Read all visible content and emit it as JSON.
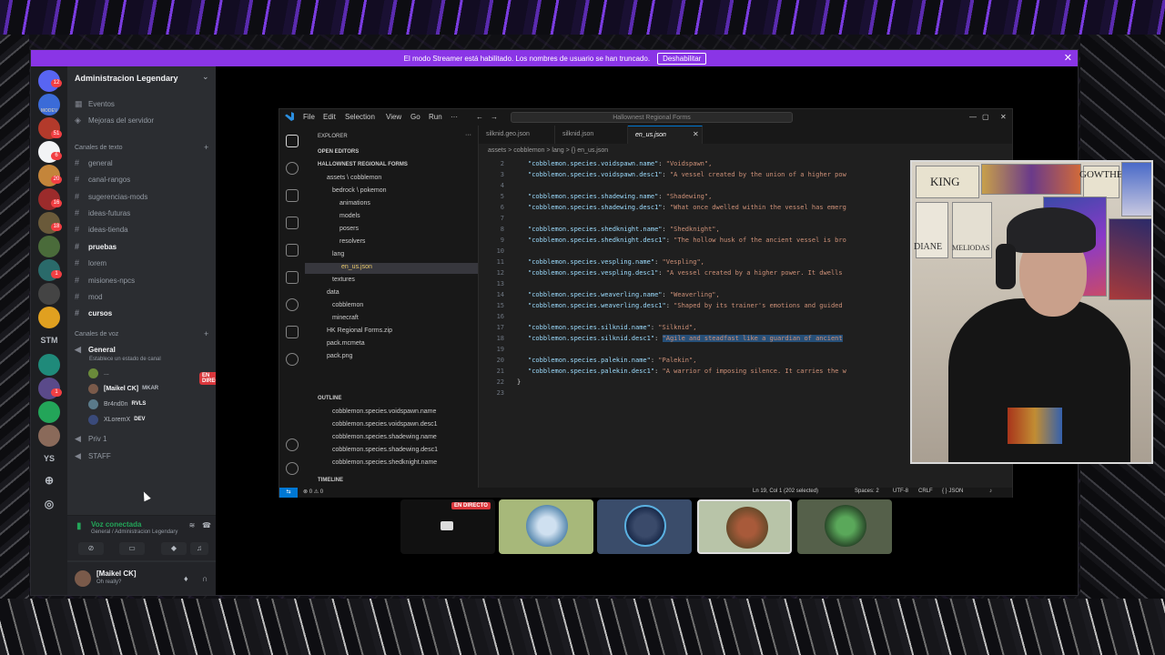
{
  "banner": {
    "text": "El modo Streamer está habilitado. Los nombres de usuario se han truncado.",
    "button": "Deshabilitar"
  },
  "servers": {
    "badges": [
      "12",
      "51",
      "6",
      "20",
      "16",
      "18",
      "1",
      "1"
    ],
    "labels": [
      "MODEV",
      "STM",
      "YS"
    ]
  },
  "server": {
    "name": "Administracion Legendary",
    "top_items": [
      "Eventos",
      "Mejoras del servidor"
    ],
    "text_category": "Canales de texto",
    "text_channels": [
      {
        "name": "general",
        "bold": false
      },
      {
        "name": "canal-rangos",
        "bold": false
      },
      {
        "name": "sugerencias-mods",
        "bold": false
      },
      {
        "name": "ideas-futuras",
        "bold": false
      },
      {
        "name": "ideas-tienda",
        "bold": false
      },
      {
        "name": "pruebas",
        "bold": true
      },
      {
        "name": "lorem",
        "bold": false
      },
      {
        "name": "misiones-npcs",
        "bold": false
      },
      {
        "name": "mod",
        "bold": false
      },
      {
        "name": "cursos",
        "bold": true
      }
    ],
    "voice_category": "Canales de voz",
    "voice_general": "General",
    "voice_status": "Establece un estado de canal",
    "voice_users": [
      {
        "name": "...",
        "tag": "",
        "live": "EN DIRECTO"
      },
      {
        "name": "[Maikel CK]",
        "tag": "MKAR"
      },
      {
        "name": "Br4nd0n",
        "tag": "RVLS"
      },
      {
        "name": "XLoremX",
        "tag": "DEV"
      }
    ],
    "other_voice": [
      "Priv 1",
      "STAFF"
    ]
  },
  "voice_panel": {
    "title": "Voz conectada",
    "subtitle": "General / Administracion Legendary"
  },
  "me": {
    "name": "[Maikel CK]",
    "status": "Oh really?"
  },
  "vscode": {
    "menu": [
      "File",
      "Edit",
      "Selection",
      "View",
      "Go",
      "Run",
      "···"
    ],
    "search": "Hallownest Regional Forms",
    "explorer_title": "EXPLORER",
    "open_editors": "OPEN EDITORS",
    "project": "HALLOWNEST REGIONAL FORMS",
    "tree": [
      "assets \\ cobblemon",
      "bedrock \\ pokemon",
      "animations",
      "models",
      "posers",
      "resolvers",
      "lang",
      "en_us.json",
      "textures",
      "data",
      "cobblemon",
      "minecraft",
      "HK Regional Forms.zip",
      "pack.mcmeta",
      "pack.png"
    ],
    "outline_title": "OUTLINE",
    "outline": [
      "cobblemon.species.voidspawn.name",
      "cobblemon.species.voidspawn.desc1",
      "cobblemon.species.shadewing.name",
      "cobblemon.species.shadewing.desc1",
      "cobblemon.species.shedknight.name"
    ],
    "timeline": "TIMELINE",
    "tabs": [
      "silknid.geo.json",
      "silknid.json",
      "en_us.json"
    ],
    "breadcrumb": "assets > cobblemon > lang > {} en_us.json",
    "lines": [
      {
        "n": "2",
        "k": "\"cobblemon.species.voidspawn.name\"",
        "v": "\"Voidspawn\","
      },
      {
        "n": "3",
        "k": "\"cobblemon.species.voidspawn.desc1\"",
        "v": "\"A vessel created by the union of a higher pow"
      },
      {
        "n": "4",
        "k": "",
        "v": ""
      },
      {
        "n": "5",
        "k": "\"cobblemon.species.shadewing.name\"",
        "v": "\"Shadewing\","
      },
      {
        "n": "6",
        "k": "\"cobblemon.species.shadewing.desc1\"",
        "v": "\"What once dwelled within the vessel has emerg"
      },
      {
        "n": "7",
        "k": "",
        "v": ""
      },
      {
        "n": "8",
        "k": "\"cobblemon.species.shedknight.name\"",
        "v": "\"Shedknight\","
      },
      {
        "n": "9",
        "k": "\"cobblemon.species.shedknight.desc1\"",
        "v": "\"The hollow husk of the ancient vessel is bro"
      },
      {
        "n": "10",
        "k": "",
        "v": ""
      },
      {
        "n": "11",
        "k": "\"cobblemon.species.vespling.name\"",
        "v": "\"Vespling\","
      },
      {
        "n": "12",
        "k": "\"cobblemon.species.vespling.desc1\"",
        "v": "\"A vessel created by a higher power. It dwells"
      },
      {
        "n": "13",
        "k": "",
        "v": ""
      },
      {
        "n": "14",
        "k": "\"cobblemon.species.weaverling.name\"",
        "v": "\"Weaverling\","
      },
      {
        "n": "15",
        "k": "\"cobblemon.species.weaverling.desc1\"",
        "v": "\"Shaped by its trainer's emotions and guided"
      },
      {
        "n": "16",
        "k": "",
        "v": ""
      },
      {
        "n": "17",
        "k": "\"cobblemon.species.silknid.name\"",
        "v": "\"Silknid\","
      },
      {
        "n": "18",
        "k": "\"cobblemon.species.silknid.desc1\"",
        "v": "\"Agile and steadfast like a guardian of ancient"
      },
      {
        "n": "19",
        "k": "",
        "v": ""
      },
      {
        "n": "20",
        "k": "\"cobblemon.species.palekin.name\"",
        "v": "\"Palekin\","
      },
      {
        "n": "21",
        "k": "\"cobblemon.species.palekin.desc1\"",
        "v": "\"A warrior of imposing silence. It carries the w"
      },
      {
        "n": "22",
        "k": "",
        "v": "}"
      },
      {
        "n": "23",
        "k": "",
        "v": ""
      }
    ],
    "status_left": "⊗ 0 ⚠ 0",
    "status_right": [
      "Ln 19, Col 1 (202 selected)",
      "Spaces: 2",
      "UTF-8",
      "CRLF",
      "{ } JSON"
    ]
  },
  "webcam": {
    "posters": [
      "KING",
      "GOWTHER",
      "DIANE",
      "MELIODAS"
    ]
  },
  "stream_tiles": {
    "live": "EN DIRECTO"
  },
  "colors": {
    "discord_bg": "#2b2d31",
    "banner": "#8a35e6",
    "live": "#da373c",
    "voice_green": "#23a559",
    "vscode_accent": "#0078d4"
  }
}
